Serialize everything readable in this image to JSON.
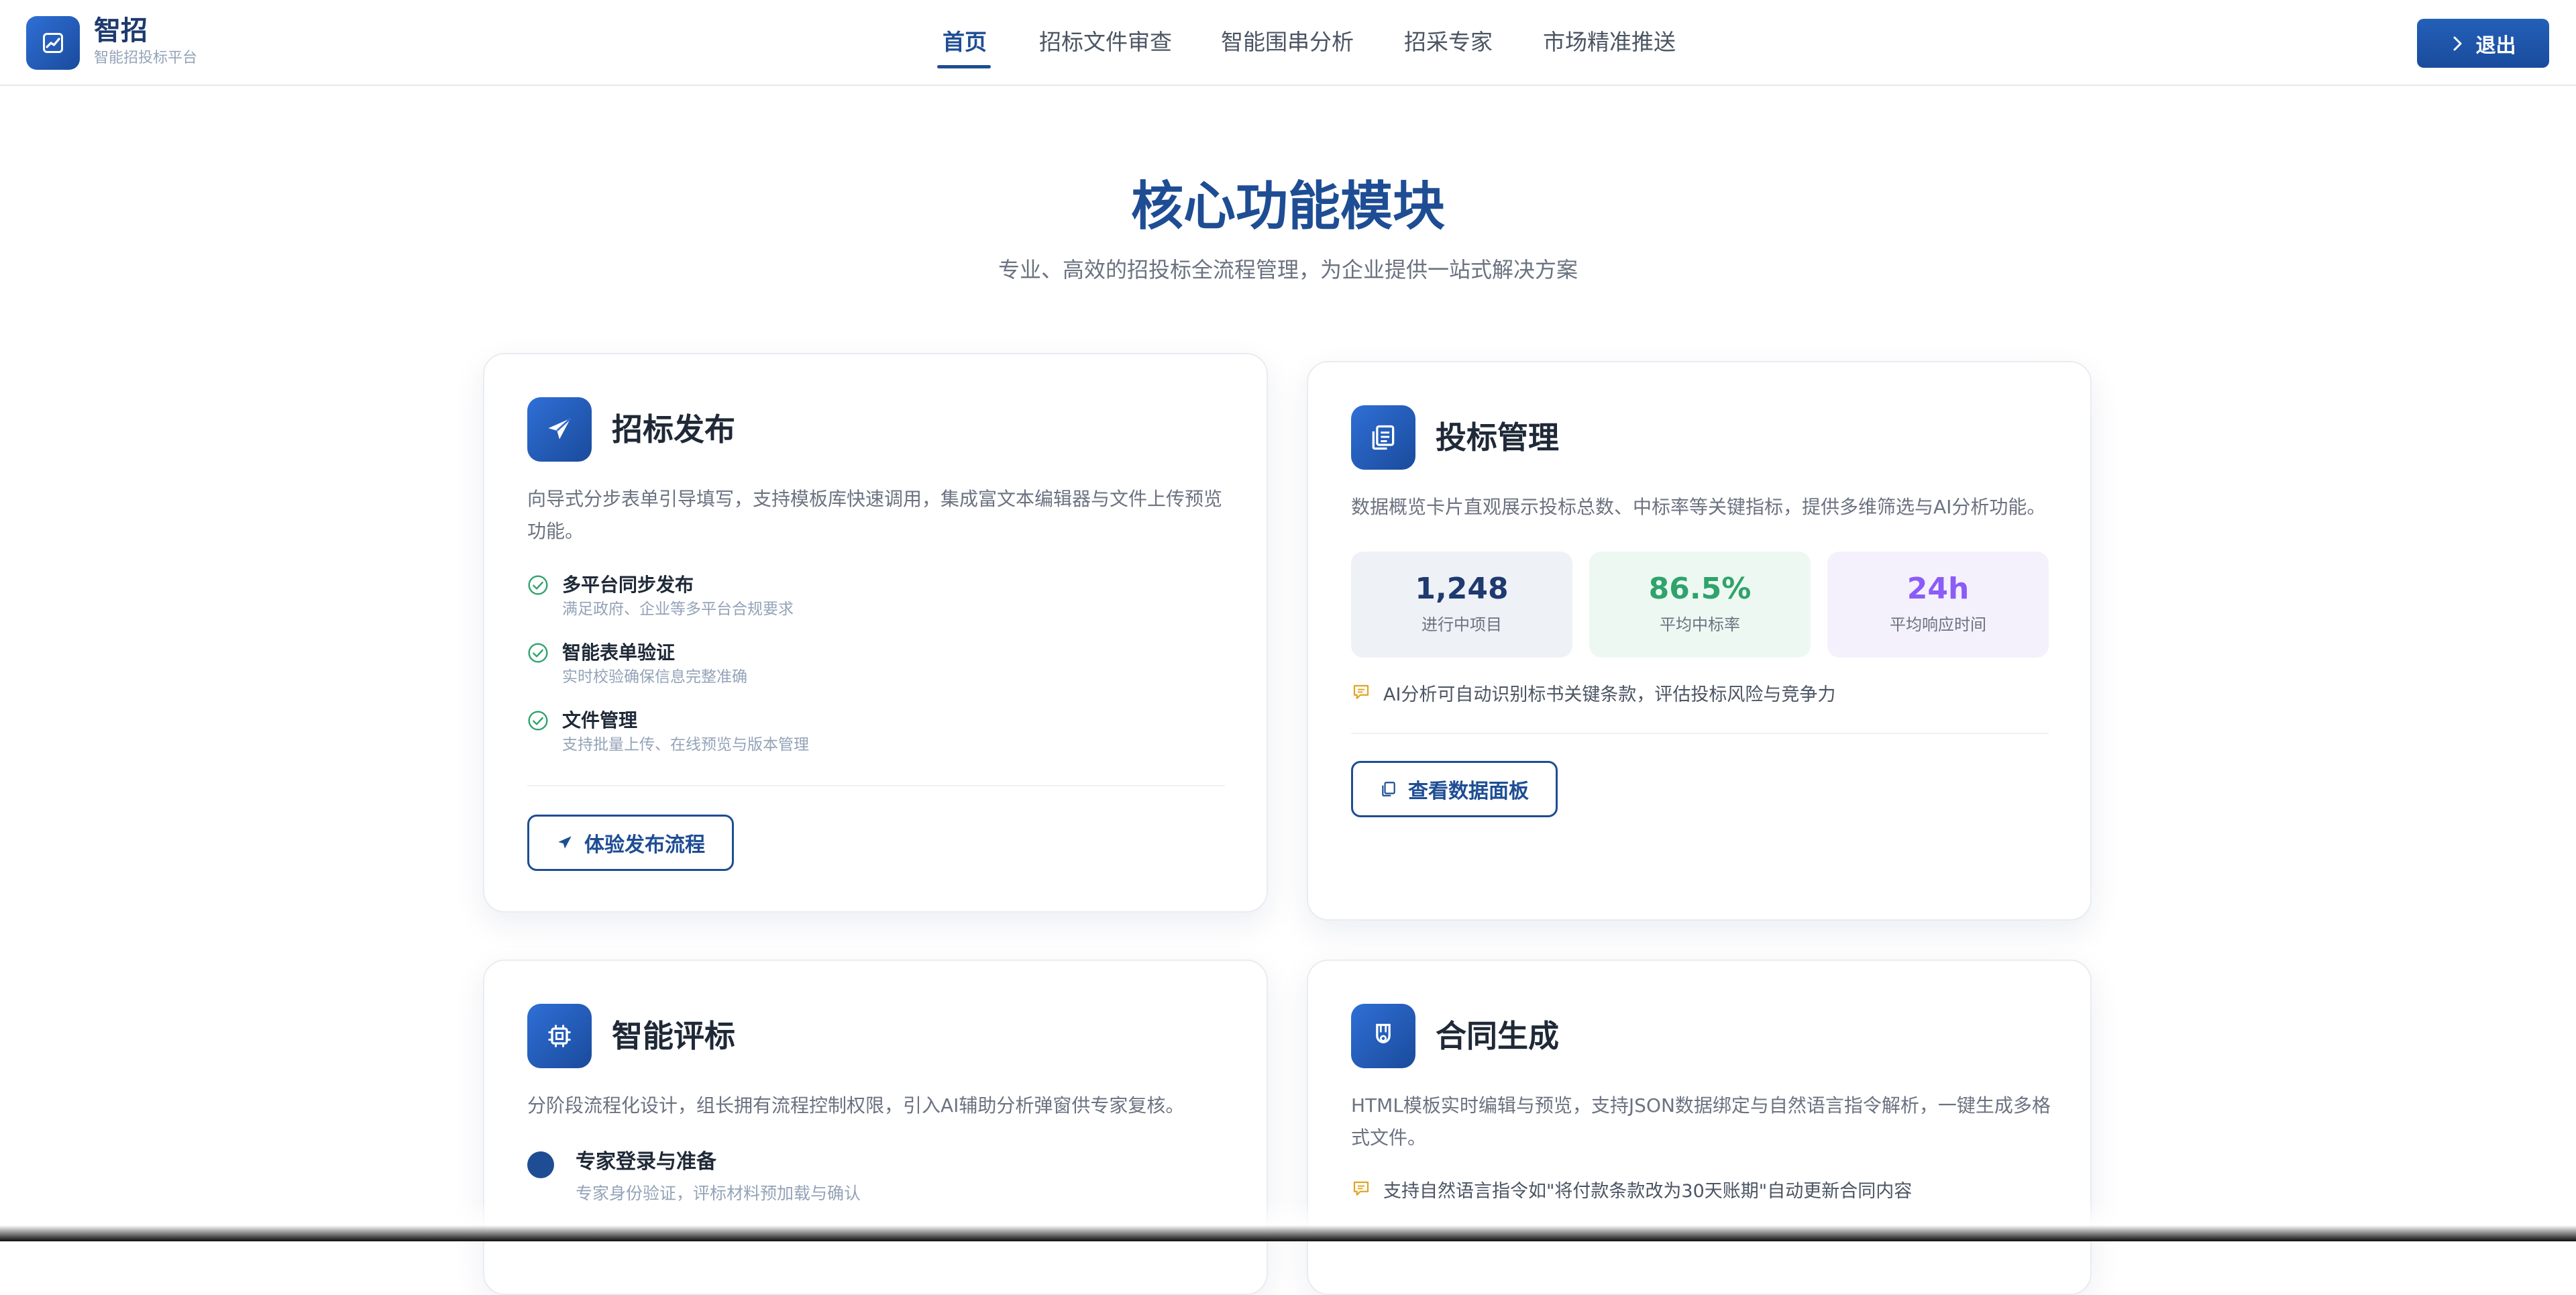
{
  "brand": {
    "name": "智招",
    "subtitle": "智能招投标平台",
    "logo_icon": "trend-chart-icon"
  },
  "nav": {
    "items": [
      {
        "label": "首页",
        "active": true
      },
      {
        "label": "招标文件审查",
        "active": false
      },
      {
        "label": "智能围串分析",
        "active": false
      },
      {
        "label": "招采专家",
        "active": false
      },
      {
        "label": "市场精准推送",
        "active": false
      }
    ],
    "logout_label": "退出",
    "logout_icon": "chevron-right-icon"
  },
  "section": {
    "title": "核心功能模块",
    "subtitle": "专业、高效的招投标全流程管理，为企业提供一站式解决方案"
  },
  "cards": {
    "publish": {
      "title": "招标发布",
      "icon": "paper-plane-icon",
      "description": "向导式分步表单引导填写，支持模板库快速调用，集成富文本编辑器与文件上传预览功能。",
      "features": [
        {
          "title": "多平台同步发布",
          "desc": "满足政府、企业等多平台合规要求"
        },
        {
          "title": "智能表单验证",
          "desc": "实时校验确保信息完整准确"
        },
        {
          "title": "文件管理",
          "desc": "支持批量上传、在线预览与版本管理"
        }
      ],
      "button_label": "体验发布流程"
    },
    "bid_mgmt": {
      "title": "投标管理",
      "icon": "documents-icon",
      "description": "数据概览卡片直观展示投标总数、中标率等关键指标，提供多维筛选与AI分析功能。",
      "stats": [
        {
          "value": "1,248",
          "label": "进行中项目",
          "color": "#1e3a6e",
          "bg": "#eef1f6"
        },
        {
          "value": "86.5%",
          "label": "平均中标率",
          "color": "#2fa36b",
          "bg": "#eef8f3"
        },
        {
          "value": "24h",
          "label": "平均响应时间",
          "color": "#8b5cf6",
          "bg": "#f4f1fd"
        }
      ],
      "note": "AI分析可自动识别标书关键条款，评估投标风险与竞争力",
      "button_label": "查看数据面板"
    },
    "evaluation": {
      "title": "智能评标",
      "icon": "chip-icon",
      "description": "分阶段流程化设计，组长拥有流程控制权限，引入AI辅助分析弹窗供专家复核。",
      "steps": [
        {
          "title": "专家登录与准备",
          "desc": "专家身份验证，评标材料预加载与确认"
        }
      ]
    },
    "contract": {
      "title": "合同生成",
      "icon": "award-icon",
      "description": "HTML模板实时编辑与预览，支持JSON数据绑定与自然语言指令解析，一键生成多格式文件。",
      "note": "支持自然语言指令如\"将付款条款改为30天账期\"自动更新合同内容"
    }
  },
  "colors": {
    "primary": "#1e4d94",
    "accent_yellow": "#e0a526",
    "success_green": "#2fa36b"
  }
}
